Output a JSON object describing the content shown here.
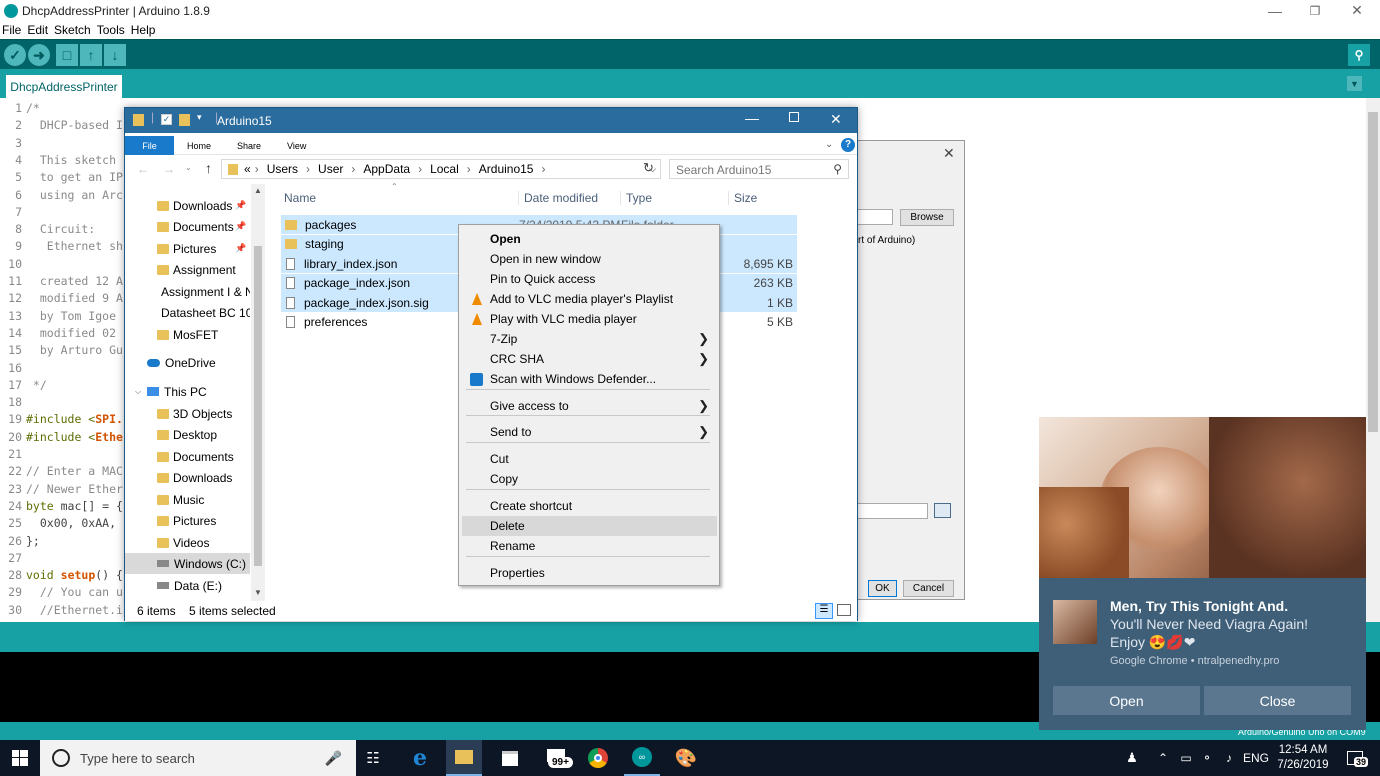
{
  "arduino": {
    "title": "DhcpAddressPrinter | Arduino 1.8.9",
    "menu": [
      "File",
      "Edit",
      "Sketch",
      "Tools",
      "Help"
    ],
    "tab": "DhcpAddressPrinter",
    "status": "Arduino/Genuino Uno on COM9",
    "lines": [
      {
        "n": "1",
        "t": "/*",
        "c": "cmt"
      },
      {
        "n": "2",
        "t": "  DHCP-based I",
        "c": "cmt"
      },
      {
        "n": "3",
        "t": "",
        "c": "cmt"
      },
      {
        "n": "4",
        "t": "  This sketch",
        "c": "cmt"
      },
      {
        "n": "5",
        "t": "  to get an IP",
        "c": "cmt"
      },
      {
        "n": "6",
        "t": "  using an Arc",
        "c": "cmt"
      },
      {
        "n": "7",
        "t": "",
        "c": "cmt"
      },
      {
        "n": "8",
        "t": "  Circuit:",
        "c": "cmt"
      },
      {
        "n": "9",
        "t": "   Ethernet sh",
        "c": "cmt"
      },
      {
        "n": "10",
        "t": "",
        "c": "cmt"
      },
      {
        "n": "11",
        "t": "  created 12 A",
        "c": "cmt"
      },
      {
        "n": "12",
        "t": "  modified 9 A",
        "c": "cmt"
      },
      {
        "n": "13",
        "t": "  by Tom Igoe",
        "c": "cmt"
      },
      {
        "n": "14",
        "t": "  modified 02",
        "c": "cmt"
      },
      {
        "n": "15",
        "t": "  by Arturo Gu",
        "c": "cmt"
      },
      {
        "n": "16",
        "t": "",
        "c": "cmt"
      },
      {
        "n": "17",
        "t": " */",
        "c": "cmt"
      },
      {
        "n": "18",
        "t": "",
        "c": ""
      },
      {
        "n": "19",
        "t": "#include <SPI.",
        "c": "inc1"
      },
      {
        "n": "20",
        "t": "#include <Ethe",
        "c": "inc2"
      },
      {
        "n": "21",
        "t": "",
        "c": ""
      },
      {
        "n": "22",
        "t": "// Enter a MAC",
        "c": "cmt"
      },
      {
        "n": "23",
        "t": "// Newer Ether",
        "c": "cmt"
      },
      {
        "n": "24",
        "t": "byte mac[] = {",
        "c": "byte"
      },
      {
        "n": "25",
        "t": "  0x00, 0xAA,",
        "c": ""
      },
      {
        "n": "26",
        "t": "};",
        "c": ""
      },
      {
        "n": "27",
        "t": "",
        "c": ""
      },
      {
        "n": "28",
        "t": "void setup() {",
        "c": "void"
      },
      {
        "n": "29",
        "t": "  // You can u",
        "c": "cmt"
      },
      {
        "n": "30",
        "t": "  //Ethernet.i",
        "c": "cmt"
      }
    ]
  },
  "dialog": {
    "browse": "Browse",
    "note": "rt of Arduino)",
    "ok": "OK",
    "cancel": "Cancel"
  },
  "explorer": {
    "title": "Arduino15",
    "ribbon": [
      "File",
      "Home",
      "Share",
      "View"
    ],
    "path": [
      "«",
      "Users",
      "User",
      "AppData",
      "Local",
      "Arduino15"
    ],
    "search_placeholder": "Search Arduino15",
    "nav": [
      {
        "label": "Downloads",
        "pin": true
      },
      {
        "label": "Documents",
        "pin": true
      },
      {
        "label": "Pictures",
        "pin": true
      },
      {
        "label": "Assignment",
        "pin": false
      },
      {
        "label": "Assignment I & N",
        "pin": false
      },
      {
        "label": "Datasheet BC 10",
        "pin": false
      },
      {
        "label": "MosFET",
        "pin": false
      },
      {
        "label": "OneDrive",
        "pin": false
      },
      {
        "label": "This PC",
        "pin": false
      },
      {
        "label": "3D Objects",
        "pin": false
      },
      {
        "label": "Desktop",
        "pin": false
      },
      {
        "label": "Documents",
        "pin": false
      },
      {
        "label": "Downloads",
        "pin": false
      },
      {
        "label": "Music",
        "pin": false
      },
      {
        "label": "Pictures",
        "pin": false
      },
      {
        "label": "Videos",
        "pin": false
      },
      {
        "label": "Windows (C:)",
        "pin": false
      },
      {
        "label": "Data (E:)",
        "pin": false
      }
    ],
    "columns": [
      "Name",
      "Date modified",
      "Type",
      "Size"
    ],
    "files": [
      {
        "name": "packages",
        "date": "7/24/2019 5:42 PM",
        "type": "File folder",
        "size": "",
        "sel": true,
        "kind": "folder"
      },
      {
        "name": "staging",
        "date": "",
        "type": "",
        "size": "",
        "sel": true,
        "kind": "folder"
      },
      {
        "name": "library_index.json",
        "date": "",
        "type": "",
        "size": "8,695 KB",
        "sel": true,
        "kind": "file"
      },
      {
        "name": "package_index.json",
        "date": "",
        "type": "",
        "size": "263 KB",
        "sel": true,
        "kind": "file"
      },
      {
        "name": "package_index.json.sig",
        "date": "",
        "type": "",
        "size": "1 KB",
        "sel": true,
        "kind": "file"
      },
      {
        "name": "preferences",
        "date": "",
        "type": "",
        "size": "5 KB",
        "sel": false,
        "kind": "file"
      }
    ],
    "item_count": "6 items",
    "selected_count": "5 items selected"
  },
  "context_menu": [
    {
      "label": "Open",
      "bold": true
    },
    {
      "label": "Open in new window"
    },
    {
      "label": "Pin to Quick access"
    },
    {
      "label": "Add to VLC media player's Playlist",
      "icon": "vlc"
    },
    {
      "label": "Play with VLC media player",
      "icon": "vlc"
    },
    {
      "label": "7-Zip",
      "sub": true
    },
    {
      "label": "CRC SHA",
      "sub": true
    },
    {
      "label": "Scan with Windows Defender...",
      "icon": "defender"
    },
    {
      "label": "Give access to",
      "sub": true
    },
    {
      "label": "Send to",
      "sub": true
    },
    {
      "label": "Cut"
    },
    {
      "label": "Copy"
    },
    {
      "label": "Create shortcut"
    },
    {
      "label": "Delete",
      "highlight": true
    },
    {
      "label": "Rename"
    },
    {
      "label": "Properties"
    }
  ],
  "notification": {
    "title": "Men, Try This Tonight And.",
    "body1": "You'll Never Need Viagra Again!",
    "body2": "Enjoy 😍💋❤",
    "source": "Google Chrome • ntralpenedhy.pro",
    "open": "Open",
    "close": "Close"
  },
  "taskbar": {
    "search_placeholder": "Type here to search",
    "store_badge": "99+",
    "language": "ENG",
    "time": "12:54 AM",
    "date": "7/26/2019",
    "notif_count": "39"
  },
  "colors": {
    "arduino_teal": "#17a1a5",
    "arduino_dark": "#006468",
    "explorer_title": "#2b6c9e",
    "selection": "#cce8ff",
    "notification_bg": "#3f5f78",
    "taskbar": "#0d1624"
  }
}
